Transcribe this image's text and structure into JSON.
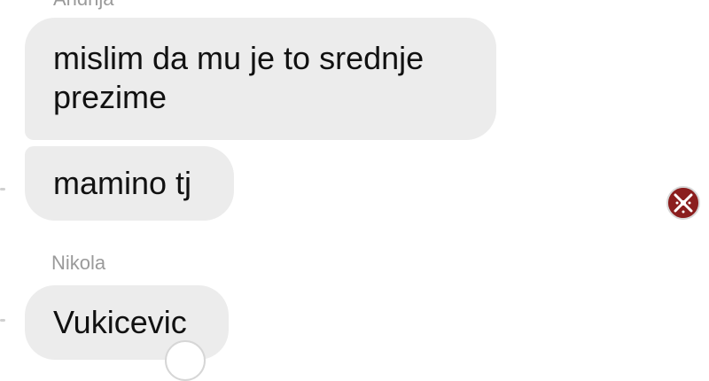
{
  "conversation": {
    "top_sender": "Andrija",
    "messages": [
      {
        "sender": "Andrija",
        "text": "mislim da mu je to srednje prezime"
      },
      {
        "sender": "Andrija",
        "text": "mamino tj"
      }
    ],
    "second_sender": "Nikola",
    "reply": {
      "sender": "Nikola",
      "text": "Vukicevic"
    }
  },
  "colors": {
    "bubble": "#ececec",
    "avatar_red": "#8b1e1e",
    "sender_gray": "#9a9a9a"
  },
  "icons": {
    "read_receipt": "avatar-crest-icon",
    "reaction": "reaction-icon"
  }
}
